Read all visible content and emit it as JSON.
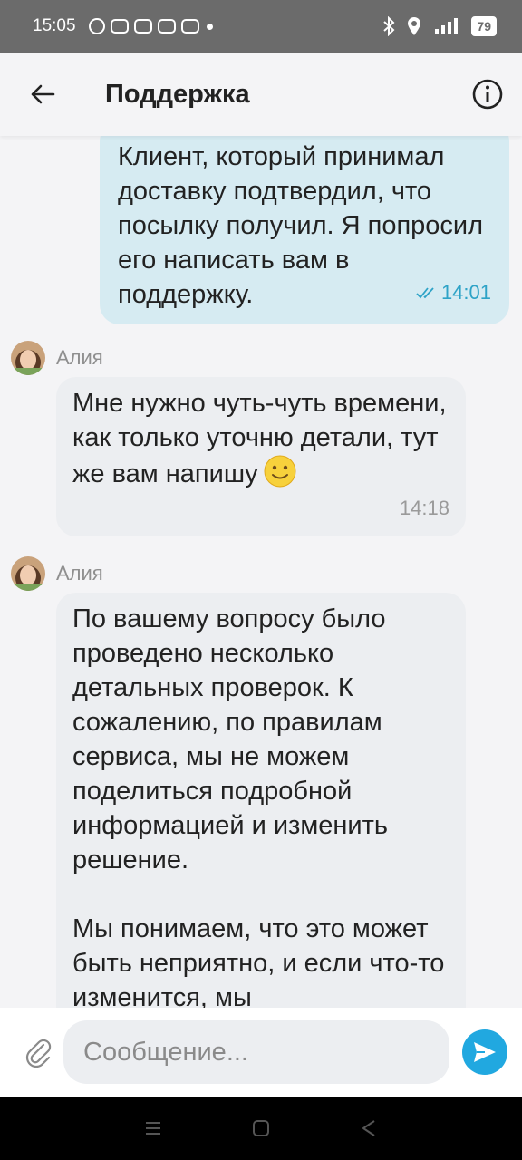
{
  "status_bar": {
    "time": "15:05",
    "battery": "79"
  },
  "header": {
    "title": "Поддержка"
  },
  "messages": [
    {
      "direction": "out",
      "text": "Клиент, который принимал доставку подтвердил, что посылку получил. Я попросил его написать вам в поддержку.",
      "time": "14:01",
      "status": "read"
    },
    {
      "direction": "in",
      "sender": "Алия",
      "text": "Мне нужно чуть-чуть времени, как только уточню детали, тут же вам напишу",
      "emoji": "slightly-smiling-face",
      "time": "14:18"
    },
    {
      "direction": "in",
      "sender": "Алия",
      "paragraph1": "По вашему вопросу было проведено несколько детальных проверок. К сожалению, по правилам сервиса, мы не можем поделиться подробной информацией и изменить решение.",
      "paragraph2": "Мы понимаем, что это может быть неприятно, и если что-то изменится, мы"
    }
  ],
  "composer": {
    "placeholder": "Сообщение..."
  },
  "colors": {
    "outgoing_bubble": "#d6ebf2",
    "incoming_bubble": "#eceef1",
    "accent": "#21a8e0"
  }
}
